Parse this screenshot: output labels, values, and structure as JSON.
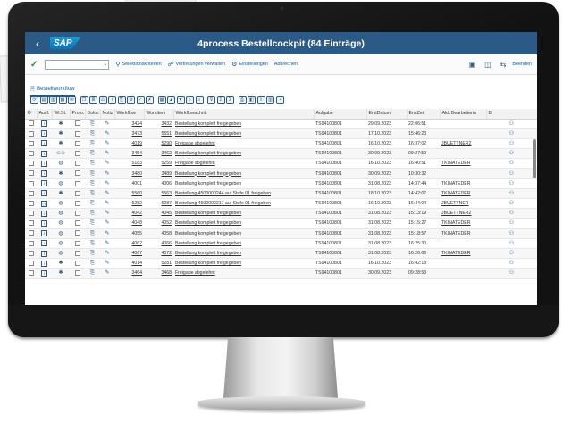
{
  "shell": {
    "back": "‹",
    "logo": "SAP",
    "title": "4process Bestellcockpit (84 Einträge)"
  },
  "toolbar": {
    "command_value": "",
    "items": [
      {
        "icon": "filter-icon",
        "glyph": "⚲",
        "label": "Selektionskriterien"
      },
      {
        "icon": "users-icon",
        "glyph": "☍",
        "label": "Vertretungen verwalten"
      },
      {
        "icon": "settings-icon",
        "glyph": "⚙",
        "label": "Einstellungen"
      },
      {
        "icon": "cancel-icon",
        "glyph": "",
        "label": "Abbrechen"
      }
    ],
    "right": [
      {
        "icon": "screen-icon",
        "glyph": "▣"
      },
      {
        "icon": "layout-icon",
        "glyph": "◫"
      },
      {
        "icon": "transfer-icon",
        "glyph": "⇆"
      }
    ],
    "end_label": "Beenden"
  },
  "tab": {
    "icon": "document-icon",
    "label": "Bestellworkflow"
  },
  "alv_buttons": [
    {
      "icon": "refresh-icon",
      "glyph": "⟳"
    },
    {
      "icon": "select-all-icon",
      "glyph": "▤"
    },
    {
      "icon": "deselect-icon",
      "glyph": "▥"
    },
    {
      "icon": "details-icon",
      "glyph": "▦"
    },
    {
      "icon": "mail-icon",
      "glyph": "✉"
    },
    {
      "icon": "copy-icon",
      "glyph": "❐"
    },
    {
      "icon": "doc-icon",
      "glyph": "≣"
    },
    {
      "icon": "history-icon",
      "glyph": "⎌"
    },
    {
      "icon": "info-icon",
      "glyph": "i"
    },
    {
      "icon": "attach-icon",
      "glyph": "⎘"
    },
    {
      "icon": "workflow-icon",
      "glyph": "⚙"
    },
    {
      "icon": "approve-icon",
      "glyph": "✓"
    },
    {
      "icon": "reject-icon",
      "glyph": "✗"
    },
    {
      "icon": "grid-icon",
      "glyph": "▦"
    },
    {
      "icon": "sort-asc-icon",
      "glyph": "▲"
    },
    {
      "icon": "sort-desc-icon",
      "glyph": "▼"
    },
    {
      "icon": "find-icon",
      "glyph": "⌕"
    },
    {
      "icon": "find-next-icon",
      "glyph": "⌕"
    },
    {
      "icon": "filter-icon",
      "glyph": "⊽"
    },
    {
      "icon": "sum-icon",
      "glyph": "Σ"
    },
    {
      "icon": "subtotal-icon",
      "glyph": "Σ"
    },
    {
      "icon": "print-icon",
      "glyph": "⎙"
    },
    {
      "icon": "view-icon",
      "glyph": "◧"
    },
    {
      "icon": "export-icon",
      "glyph": "⇪"
    },
    {
      "icon": "layout-icon",
      "glyph": "▥"
    },
    {
      "icon": "chart-icon",
      "glyph": "◔"
    }
  ],
  "table": {
    "columns": [
      "",
      "Ausf.",
      "Wi.St.",
      "Proto.",
      "Doku.",
      "Notiz",
      "Workflow",
      "Workitem",
      "Workflowschritt",
      "Aufgabe",
      "ErstDatum",
      "ErstZeit",
      "Akt. Bearbeiterin",
      "B"
    ],
    "rows": [
      {
        "ausf": "info-icon",
        "wist": "gear-icon",
        "workflow": "3424",
        "workitem": "3432",
        "step": "Bestellung komplett freigegeben",
        "task": "TS94100801",
        "date": "29.09.2023",
        "time": "22:06:51",
        "agent": ""
      },
      {
        "ausf": "info-icon",
        "wist": "gear-icon",
        "workflow": "3473",
        "workitem": "5551",
        "step": "Bestellung komplett freigegeben",
        "task": "TS94100801",
        "date": "17.10.2023",
        "time": "15:46:23",
        "agent": ""
      },
      {
        "ausf": "info-icon",
        "wist": "gear-icon",
        "workflow": "4019",
        "workitem": "5290",
        "step": "Freigabe abgelehnt",
        "task": "TS94100801",
        "date": "16.10.2023",
        "time": "16:37:02",
        "agent": "JBUETTNER2"
      },
      {
        "ausf": "info-icon",
        "wist": "link-icon",
        "workflow": "3454",
        "workitem": "3462",
        "step": "Bestellung komplett freigegeben",
        "task": "TS94100801",
        "date": "30.09.2023",
        "time": "09:27:50",
        "agent": ""
      },
      {
        "ausf": "info-icon",
        "wist": "status-icon",
        "workflow": "5183",
        "workitem": "5259",
        "step": "Freigabe abgelehnt",
        "task": "TS94100801",
        "date": "16.10.2023",
        "time": "16:40:51",
        "agent": "TKINATEDER"
      },
      {
        "ausf": "info-icon",
        "wist": "gear-icon",
        "workflow": "3480",
        "workitem": "3489",
        "step": "Bestellung komplett freigegeben",
        "task": "TS94100801",
        "date": "30.09.2023",
        "time": "10:30:32",
        "agent": ""
      },
      {
        "ausf": "info-icon",
        "wist": "status-icon",
        "workflow": "4001",
        "workitem": "4006",
        "step": "Bestellung komplett freigegeben",
        "task": "TS94100801",
        "date": "31.08.2023",
        "time": "14:37:44",
        "agent": "TKINATEDER"
      },
      {
        "ausf": "info-icon",
        "wist": "gear-icon",
        "workflow": "5560",
        "workitem": "5563",
        "step": "Bestellung 4500000244 auf Stufe 01 freigeben",
        "task": "TS94100801",
        "date": "18.10.2023",
        "time": "14:42:07",
        "agent": "TKINATEDER"
      },
      {
        "ausf": "clock-icon",
        "wist": "status-icon",
        "workflow": "5282",
        "workitem": "5287",
        "step": "Bestellung 4500000217 auf Stufe 01 freigeben",
        "task": "TS94100801",
        "date": "16.10.2023",
        "time": "16:44:04",
        "agent": "JBUETTNER"
      },
      {
        "ausf": "info-icon",
        "wist": "status-icon",
        "workflow": "4042",
        "workitem": "4045",
        "step": "Bestellung komplett freigegeben",
        "task": "TS94100801",
        "date": "31.08.2023",
        "time": "15:13:19",
        "agent": "JBUETTNER2"
      },
      {
        "ausf": "info-icon",
        "wist": "status-icon",
        "workflow": "4048",
        "workitem": "4052",
        "step": "Bestellung komplett freigegeben",
        "task": "TS94100801",
        "date": "31.08.2023",
        "time": "15:15:27",
        "agent": "TKINATEDER"
      },
      {
        "ausf": "info-icon",
        "wist": "status-icon",
        "workflow": "4055",
        "workitem": "4058",
        "step": "Bestellung komplett freigegeben",
        "task": "TS94100801",
        "date": "31.08.2023",
        "time": "15:18:57",
        "agent": "TKINATEDER"
      },
      {
        "ausf": "info-icon",
        "wist": "status-icon",
        "workflow": "4062",
        "workitem": "4066",
        "step": "Bestellung komplett freigegeben",
        "task": "TS94100801",
        "date": "31.08.2023",
        "time": "16:25:30",
        "agent": ""
      },
      {
        "ausf": "info-icon",
        "wist": "status-icon",
        "workflow": "4067",
        "workitem": "4072",
        "step": "Bestellung komplett freigegeben",
        "task": "TS94100801",
        "date": "31.08.2023",
        "time": "16:26:06",
        "agent": "TKINATEDER"
      },
      {
        "ausf": "info-icon",
        "wist": "gear-icon",
        "workflow": "4014",
        "workitem": "5281",
        "step": "Bestellung komplett freigegeben",
        "task": "TS94100801",
        "date": "16.10.2023",
        "time": "16:42:18",
        "agent": ""
      },
      {
        "ausf": "info-icon",
        "wist": "gear-icon",
        "workflow": "3464",
        "workitem": "3468",
        "step": "Freigabe abgelehnt",
        "task": "TS94100801",
        "date": "30.09.2023",
        "time": "09:28:53",
        "agent": ""
      }
    ]
  },
  "colors": {
    "shell": "#2c5a86",
    "link": "#0a3e7a",
    "accent": "#0a5ea8"
  }
}
